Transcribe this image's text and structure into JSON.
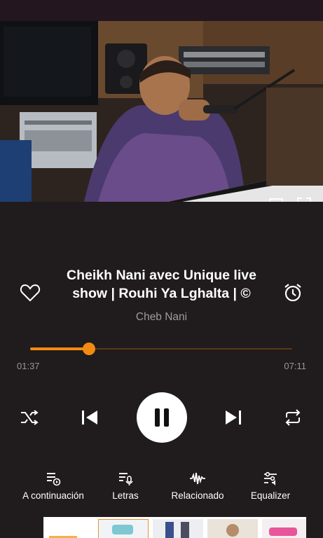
{
  "now_playing": {
    "title": "Cheikh Nani avec Unique live show | Rouhi Ya Lghalta | ©",
    "artist": "Cheb Nani",
    "elapsed": "01:37",
    "duration": "07:11",
    "progress_fraction": 0.225
  },
  "tabs": [
    {
      "label": "A continuación",
      "icon": "queue-icon"
    },
    {
      "label": "Letras",
      "icon": "lyrics-icon"
    },
    {
      "label": "Relacionado",
      "icon": "waveform-icon"
    },
    {
      "label": "Equalizer",
      "icon": "equalizer-icon"
    }
  ],
  "colors": {
    "accent": "#f28a12",
    "background": "#201b1c",
    "muted_text": "#a09c9c"
  }
}
